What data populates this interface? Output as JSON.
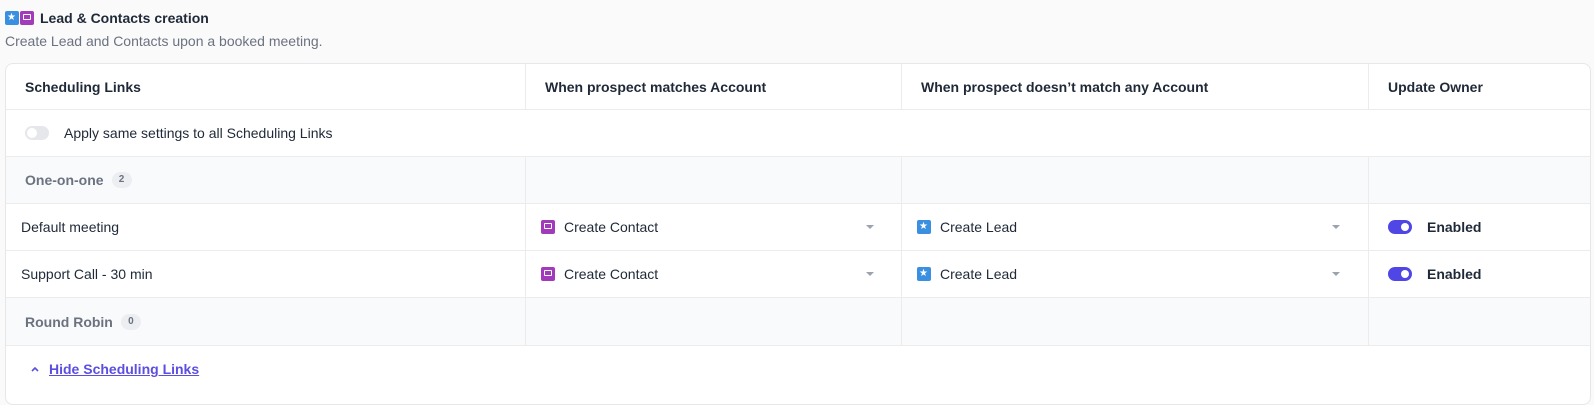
{
  "header": {
    "title": "Lead & Contacts creation",
    "subtitle": "Create Lead and Contacts upon a booked meeting."
  },
  "columns": {
    "scheduling_links": "Scheduling Links",
    "matches_account": "When prospect matches Account",
    "no_match_account": "When prospect doesn’t match any Account",
    "update_owner": "Update Owner"
  },
  "apply_all": {
    "label": "Apply same settings to all Scheduling Links",
    "enabled": false
  },
  "groups": {
    "one_on_one": {
      "label": "One-on-one",
      "count": "2"
    },
    "round_robin": {
      "label": "Round Robin",
      "count": "0"
    }
  },
  "links": [
    {
      "name": "Default meeting",
      "match_action": "Create Contact",
      "nomatch_action": "Create Lead",
      "owner_status": "Enabled",
      "owner_enabled": true
    },
    {
      "name": "Support Call - 30 min",
      "match_action": "Create Contact",
      "nomatch_action": "Create Lead",
      "owner_status": "Enabled",
      "owner_enabled": true
    }
  ],
  "footer": {
    "hide_label": "Hide Scheduling Links"
  },
  "colors": {
    "accent": "#4f46e5",
    "lead_icon": "#3b8fe0",
    "contact_icon": "#a23bb9"
  }
}
